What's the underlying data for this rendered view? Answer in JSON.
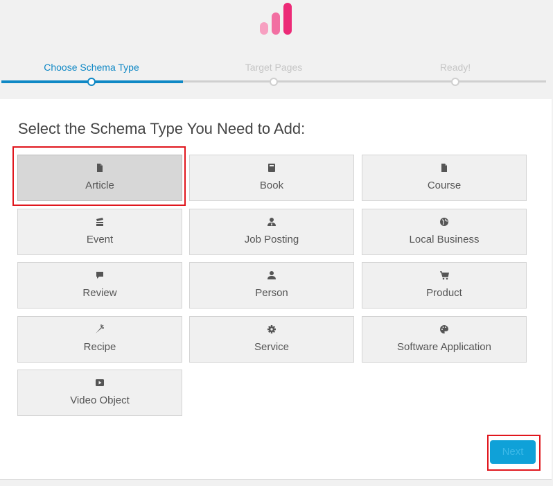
{
  "colors": {
    "accent": "#0f88c5",
    "inactive": "#c8c8c8",
    "highlight": "#e0161d",
    "logo_light": "#f686b0",
    "logo_dark": "#ec2a77"
  },
  "steps": [
    {
      "label": "Choose Schema Type",
      "state": "active"
    },
    {
      "label": "Target Pages",
      "state": "inactive"
    },
    {
      "label": "Ready!",
      "state": "inactive"
    }
  ],
  "main": {
    "heading": "Select the Schema Type You Need to Add:",
    "tiles": [
      {
        "label": "Article",
        "icon": "document-icon",
        "selected": true
      },
      {
        "label": "Book",
        "icon": "book-icon"
      },
      {
        "label": "Course",
        "icon": "document-icon"
      },
      {
        "label": "Event",
        "icon": "calendar-stack-icon"
      },
      {
        "label": "Job Posting",
        "icon": "user-tie-icon"
      },
      {
        "label": "Local Business",
        "icon": "globe-icon"
      },
      {
        "label": "Review",
        "icon": "speech-bubble-icon"
      },
      {
        "label": "Person",
        "icon": "user-icon"
      },
      {
        "label": "Product",
        "icon": "cart-icon"
      },
      {
        "label": "Recipe",
        "icon": "carrot-icon"
      },
      {
        "label": "Service",
        "icon": "gear-icon"
      },
      {
        "label": "Software Application",
        "icon": "palette-icon"
      },
      {
        "label": "Video Object",
        "icon": "play-icon"
      }
    ]
  },
  "footer": {
    "next_label": "Next"
  }
}
